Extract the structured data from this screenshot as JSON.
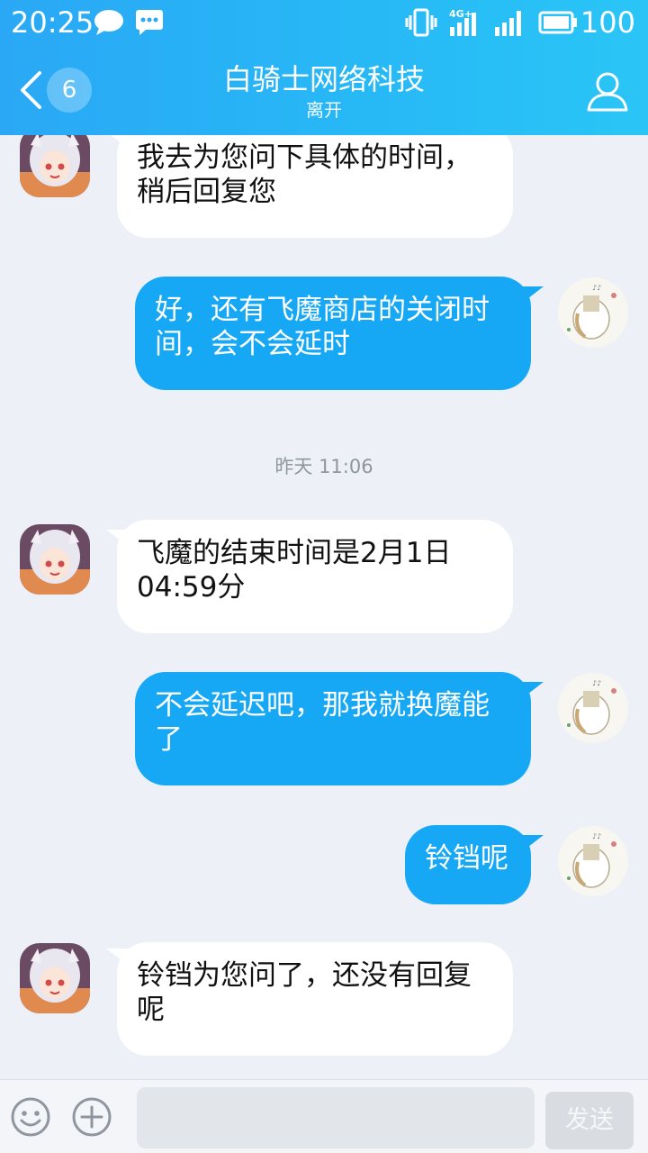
{
  "status_bar": {
    "time": "20:25",
    "network": "4G",
    "battery": "100"
  },
  "nav": {
    "unread_count": "6",
    "title": "白骑士网络科技",
    "subtitle": "离开"
  },
  "messages": [
    {
      "side": "left",
      "text_lines": [
        "我去为您问下具体的时间，",
        "稍后回复您"
      ]
    },
    {
      "side": "right",
      "text_lines": [
        "好，还有飞魔商店的关闭时",
        "间，会不会延时"
      ]
    },
    {
      "timestamp": "昨天 11:06"
    },
    {
      "side": "left",
      "text_lines": [
        "飞魔的结束时间是2月1日",
        "04:59分"
      ]
    },
    {
      "side": "right",
      "text_lines": [
        "不会延迟吧，那我就换魔能",
        "了"
      ]
    },
    {
      "side": "right",
      "text_lines": [
        "铃铛呢"
      ]
    },
    {
      "side": "left",
      "text_lines": [
        "铃铛为您问了，还没有回复",
        "呢"
      ]
    }
  ],
  "input_bar": {
    "placeholder": "",
    "send_label": "发送"
  },
  "colors": {
    "header_gradient_start": "#2aa8f5",
    "header_gradient_end": "#2ac5f6",
    "outgoing_bubble": "#16a8f4",
    "incoming_bubble": "#ffffff",
    "chat_background": "#edf1f7"
  }
}
